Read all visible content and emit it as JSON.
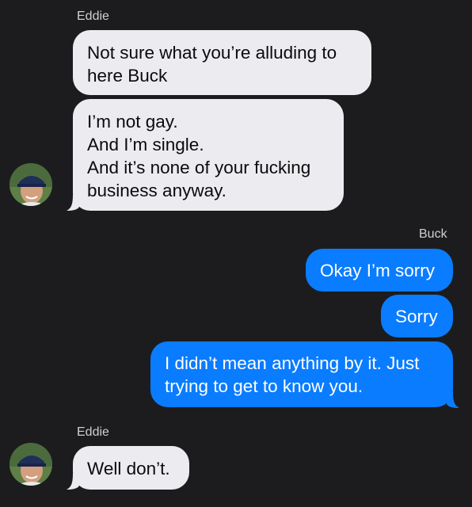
{
  "conversation": {
    "groups": [
      {
        "sender": "Eddie",
        "messages": [
          "Not sure what you’re alluding to\nhere Buck",
          "I’m not gay.\nAnd I’m single.\nAnd it’s none of your fucking\nbusiness anyway."
        ]
      },
      {
        "sender": "Buck",
        "messages": [
          "Okay I’m sorry",
          "Sorry",
          "I didn’t mean anything by it. Just\ntrying to get to know you."
        ]
      },
      {
        "sender": "Eddie",
        "messages": [
          "Well don’t."
        ]
      }
    ]
  },
  "colors": {
    "background": "#1c1c1e",
    "incoming_bubble": "#ececf0",
    "outgoing_bubble": "#0a7cff",
    "sender_label": "#cfcfd4"
  },
  "icons": {
    "avatar": "contact-photo-avatar"
  }
}
